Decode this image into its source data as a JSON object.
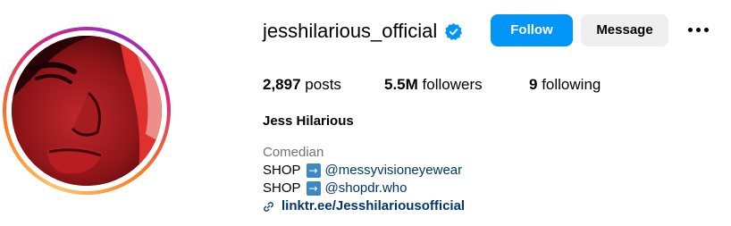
{
  "profile": {
    "username": "jesshilarious_official",
    "verified": true,
    "full_name": "Jess Hilarious",
    "category": "Comedian"
  },
  "actions": {
    "follow_label": "Follow",
    "message_label": "Message",
    "more_icon": "more-horizontal-icon"
  },
  "stats": {
    "posts_count": "2,897",
    "posts_label": "posts",
    "followers_count": "5.5M",
    "followers_label": "followers",
    "following_count": "9",
    "following_label": "following"
  },
  "bio": {
    "line1_prefix": "SHOP",
    "line1_arrow": "→",
    "line1_mention": "@messyvisioneyewear",
    "line2_prefix": "SHOP",
    "line2_arrow": "→",
    "line2_mention": "@shopdr.who",
    "link_text": "linktr.ee/Jesshilariousofficial",
    "link_icon": "link-icon"
  },
  "colors": {
    "follow_button": "#0095f6",
    "message_button": "#efefef",
    "link": "#00376b",
    "category": "#737373",
    "verified_badge": "#0095f6"
  }
}
